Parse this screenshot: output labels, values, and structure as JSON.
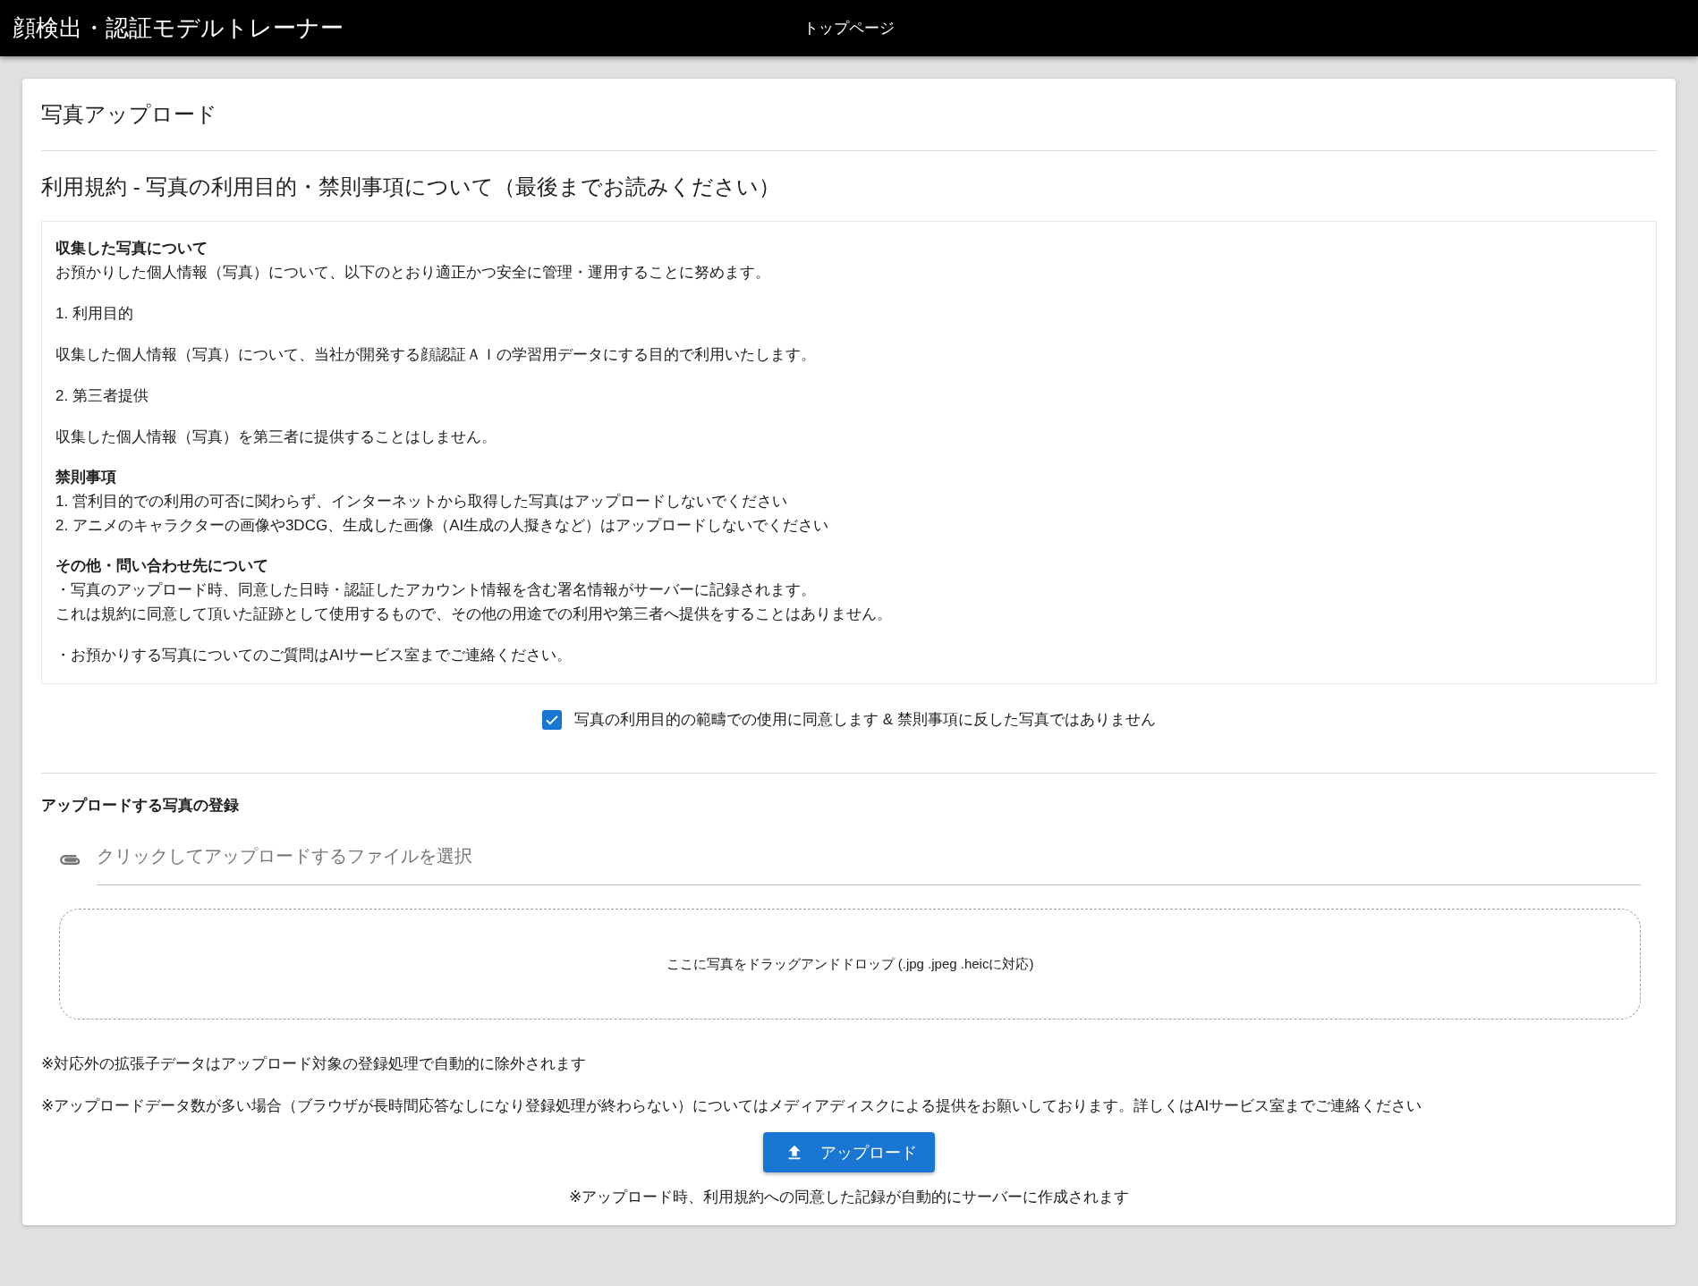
{
  "header": {
    "title": "顔検出・認証モデルトレーナー",
    "nav_link": "トップページ"
  },
  "card": {
    "title": "写真アップロード",
    "terms": {
      "title": "利用規約 - 写真の利用目的・禁則事項について（最後までお読みください）",
      "sections": [
        {
          "heading": "収集した写真について",
          "paragraphs": [
            [
              "お預かりした個人情報（写真）について、以下のとおり適正かつ安全に管理・運用することに努めます。"
            ],
            [
              "1. 利用目的"
            ],
            [
              "収集した個人情報（写真）について、当社が開発する顔認証ＡＩの学習用データにする目的で利用いたします。"
            ],
            [
              "2. 第三者提供"
            ],
            [
              "収集した個人情報（写真）を第三者に提供することはしません。"
            ]
          ]
        },
        {
          "heading": "禁則事項",
          "paragraphs": [
            [
              "1. 営利目的での利用の可否に関わらず、インターネットから取得した写真はアップロードしないでください",
              "2. アニメのキャラクターの画像や3DCG、生成した画像（AI生成の人擬きなど）はアップロードしないでください"
            ]
          ]
        },
        {
          "heading": "その他・問い合わせ先について",
          "paragraphs": [
            [
              "・写真のアップロード時、同意した日時・認証したアカウント情報を含む署名情報がサーバーに記録されます。",
              "これは規約に同意して頂いた証跡として使用するもので、その他の用途での利用や第三者へ提供をすることはありません。"
            ],
            [
              "・お預かりする写真についてのご質問はAIサービス室までご連絡ください。"
            ]
          ]
        }
      ]
    },
    "agreement": {
      "label": "写真の利用目的の範疇での使用に同意します & 禁則事項に反した写真ではありません",
      "checked": true
    },
    "upload": {
      "heading": "アップロードする写真の登録",
      "file_field": {
        "placeholder": "クリックしてアップロードするファイルを選択"
      },
      "drop_zone": "ここに写真をドラッグアンドドロップ (.jpg .jpeg .heicに対応)",
      "notes": [
        "※対応外の拡張子データはアップロード対象の登録処理で自動的に除外されます",
        "※アップロードデータ数が多い場合（ブラウザが長時間応答なしになり登録処理が終わらない）についてはメディアディスクによる提供をお願いしております。詳しくはAIサービス室までご連絡ください"
      ],
      "button": "アップロード",
      "footnote": "※アップロード時、利用規約への同意した記録が自動的にサーバーに作成されます"
    }
  }
}
